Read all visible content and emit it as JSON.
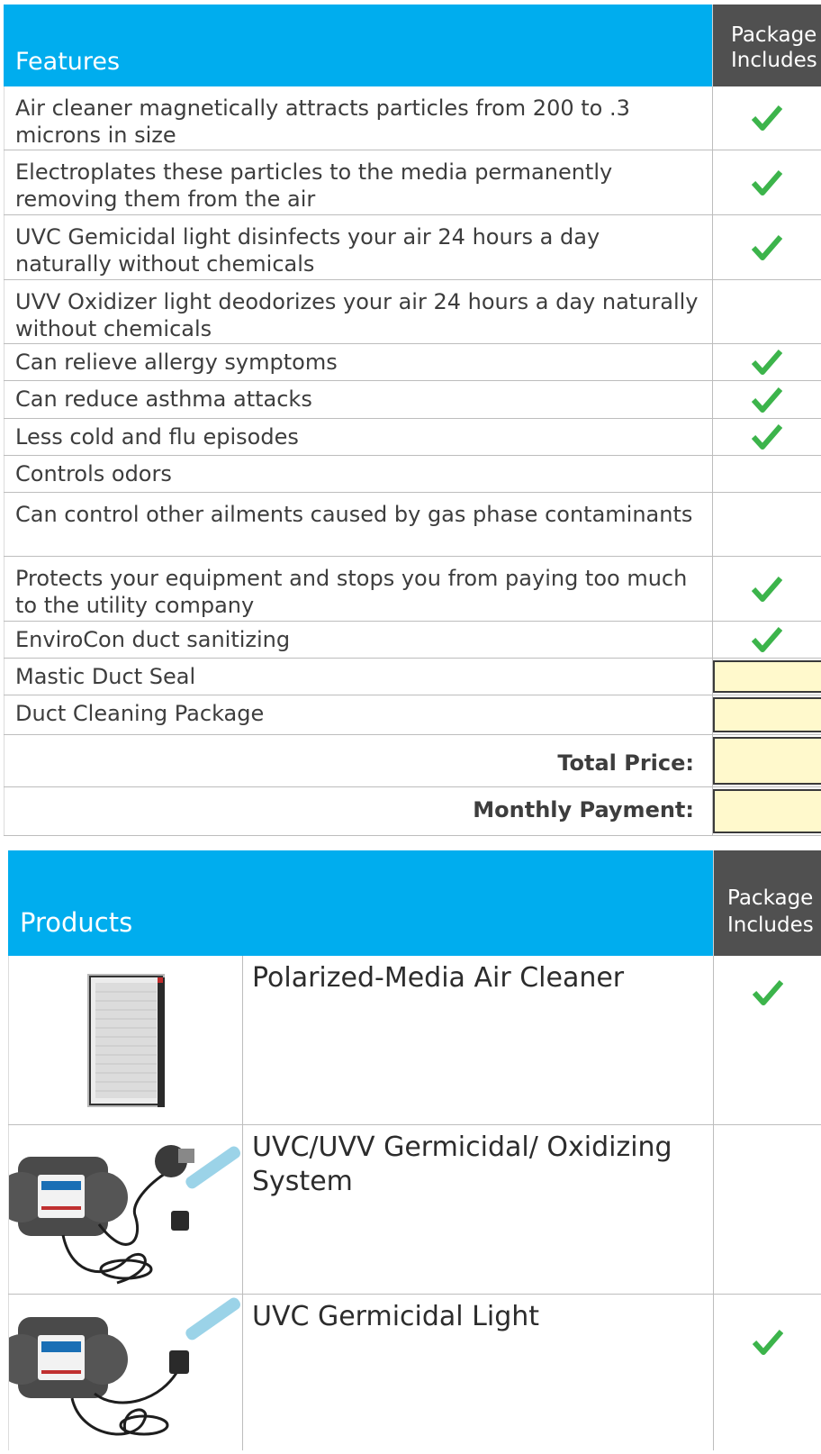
{
  "features": {
    "header": {
      "title": "Features",
      "package_label": "Package Includes"
    },
    "rows": [
      {
        "text": "Air cleaner magnetically attracts particles from 200 to .3 microns in size",
        "included": true
      },
      {
        "text": "Electroplates these particles to the media permanently removing them from the air",
        "included": true
      },
      {
        "text": "UVC Gemicidal light disinfects your air 24 hours a day naturally without chemicals",
        "included": true
      },
      {
        "text": "UVV Oxidizer light deodorizes your air 24 hours a day naturally without chemicals",
        "included": false
      },
      {
        "text": "Can relieve allergy symptoms",
        "included": true
      },
      {
        "text": "Can reduce asthma attacks",
        "included": true
      },
      {
        "text": "Less cold and flu episodes",
        "included": true
      },
      {
        "text": "Controls odors",
        "included": false
      },
      {
        "text": "Can control other ailments caused by gas phase contaminants",
        "included": false
      },
      {
        "text": "Protects your equipment and stops you from paying too much to the utility company",
        "included": true
      },
      {
        "text": "EnviroCon duct sanitizing",
        "included": true
      }
    ],
    "input_rows": [
      {
        "text": "Mastic Duct Seal"
      },
      {
        "text": "Duct Cleaning Package"
      }
    ],
    "summary": {
      "total_price_label": "Total Price:",
      "monthly_payment_label": "Monthly Payment:"
    }
  },
  "products": {
    "header": {
      "title": "Products",
      "package_label": "Package Includes"
    },
    "rows": [
      {
        "name": "Polarized-Media Air Cleaner",
        "image": "air-filter-image",
        "included": true
      },
      {
        "name": "UVC/UVV Germicidal/ Oxidizing System",
        "image": "uv-system-image",
        "included": false
      },
      {
        "name": "UVC Germicidal Light",
        "image": "uv-light-image",
        "included": true
      }
    ]
  },
  "colors": {
    "header_blue": "#00adee",
    "header_gray": "#505050",
    "check_green": "#3cb44b",
    "input_yellow": "#fff9cc"
  }
}
